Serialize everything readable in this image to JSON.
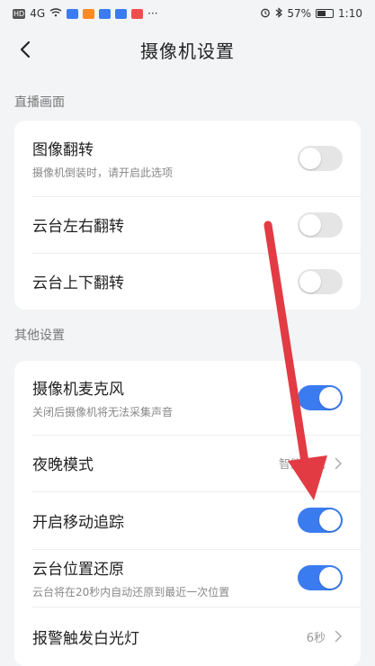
{
  "status": {
    "left_icons": [
      {
        "name": "hd-icon",
        "text": "HD"
      },
      {
        "name": "signal-4g-icon",
        "text": "4G"
      },
      {
        "name": "wifi-icon",
        "text": ""
      },
      {
        "name": "app-notification-icon",
        "text": ""
      },
      {
        "name": "media-icon",
        "text": ""
      },
      {
        "name": "app-notification-icon",
        "text": ""
      },
      {
        "name": "app-notification-icon",
        "text": ""
      },
      {
        "name": "app-notification-icon",
        "text": ""
      },
      {
        "name": "more-icon",
        "text": "···"
      }
    ],
    "battery": "57%",
    "time": "1:10"
  },
  "header": {
    "title": "摄像机设置"
  },
  "sections": [
    {
      "title": "直播画面",
      "rows": [
        {
          "label": "图像翻转",
          "sub": "摄像机倒装时，请开启此选项",
          "toggle": false
        },
        {
          "label": "云台左右翻转",
          "toggle": false
        },
        {
          "label": "云台上下翻转",
          "toggle": false
        }
      ]
    },
    {
      "title": "其他设置",
      "rows": [
        {
          "label": "摄像机麦克风",
          "sub": "关闭后摄像机将无法采集声音",
          "toggle": true
        },
        {
          "label": "夜晚模式",
          "value": "智能夜视"
        },
        {
          "label": "开启移动追踪",
          "toggle": true
        },
        {
          "label": "云台位置还原",
          "sub": "云台将在20秒内自动还原到最近一次位置",
          "toggle": true
        },
        {
          "label": "报警触发白光灯",
          "value": "6秒"
        }
      ]
    }
  ],
  "colors": {
    "accent": "#3a7cf0",
    "annotation_arrow": "#e23b44",
    "background": "#f3f4f6"
  }
}
